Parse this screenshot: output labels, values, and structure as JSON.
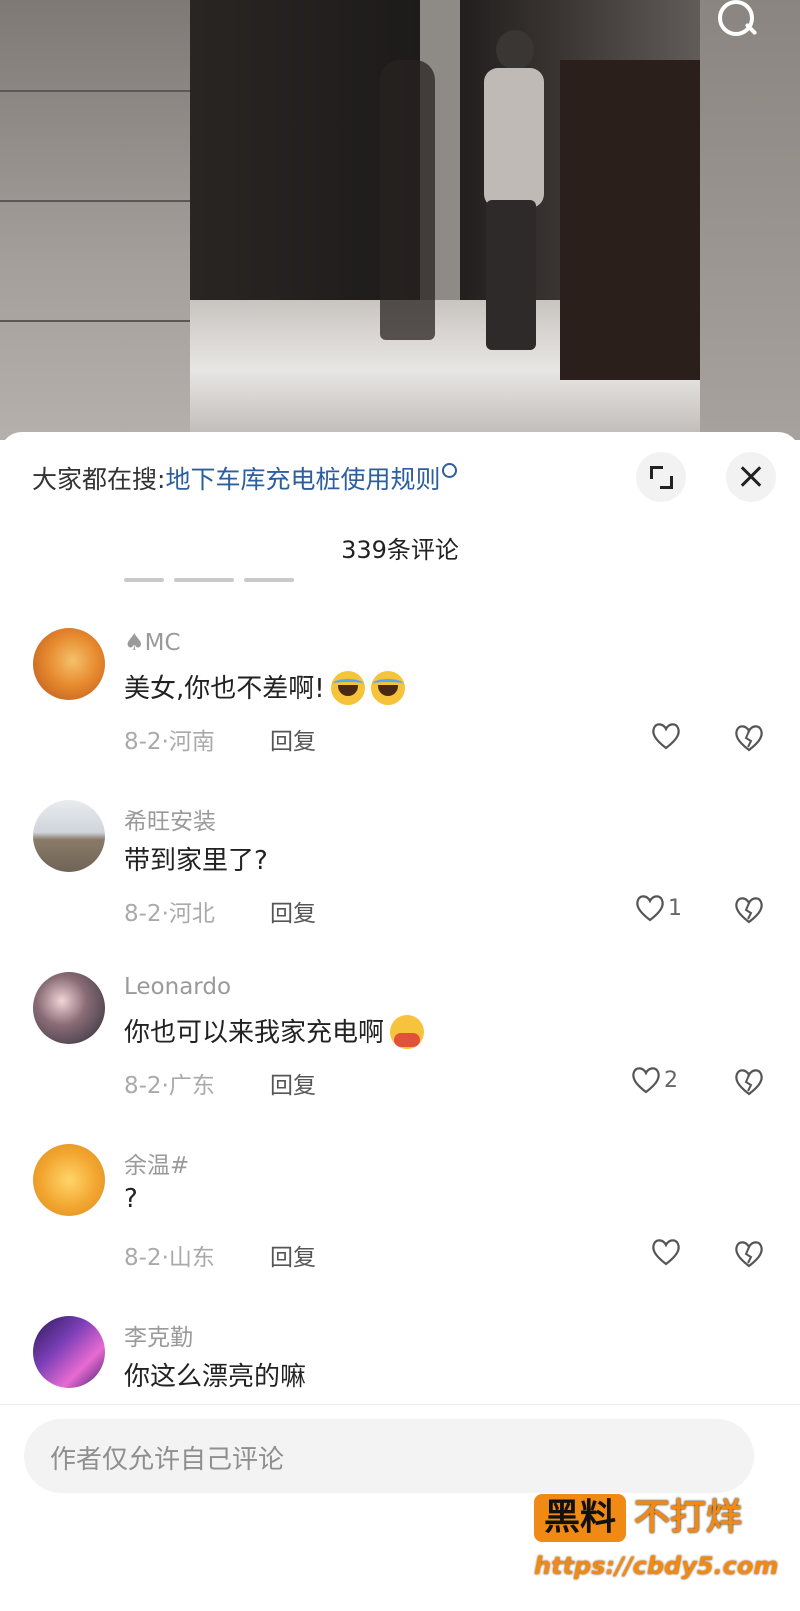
{
  "hot_search": {
    "prefix": "大家都在搜:",
    "keyword": "地下车库充电桩使用规则"
  },
  "comments_header": {
    "count_label": "339条评论"
  },
  "comments": [
    {
      "username": "♠MC",
      "text": "美女,你也不差啊!",
      "emoji": "laugh-cry",
      "date_location": "8-2·河南",
      "reply": "回复",
      "likes": ""
    },
    {
      "username": "希旺安装",
      "text": "带到家里了?",
      "emoji": "",
      "date_location": "8-2·河北",
      "reply": "回复",
      "likes": "1"
    },
    {
      "username": "Leonardo",
      "text": "你也可以来我家充电啊",
      "emoji": "hug",
      "date_location": "8-2·广东",
      "reply": "回复",
      "likes": "2"
    },
    {
      "username": "余温#",
      "text": "?",
      "emoji": "",
      "date_location": "8-2·山东",
      "reply": "回复",
      "likes": ""
    },
    {
      "username": "李克勤",
      "text": "你这么漂亮的嘛",
      "emoji": "",
      "date_location": "",
      "reply": "",
      "likes": ""
    }
  ],
  "input": {
    "placeholder": "作者仅允许自己评论"
  },
  "watermark": {
    "badge": "黑料",
    "tail": "不打烊",
    "url": "https://cbdy5.com"
  },
  "colors": {
    "keyword": "#2d5e9e",
    "watermark": "#f18a14"
  }
}
